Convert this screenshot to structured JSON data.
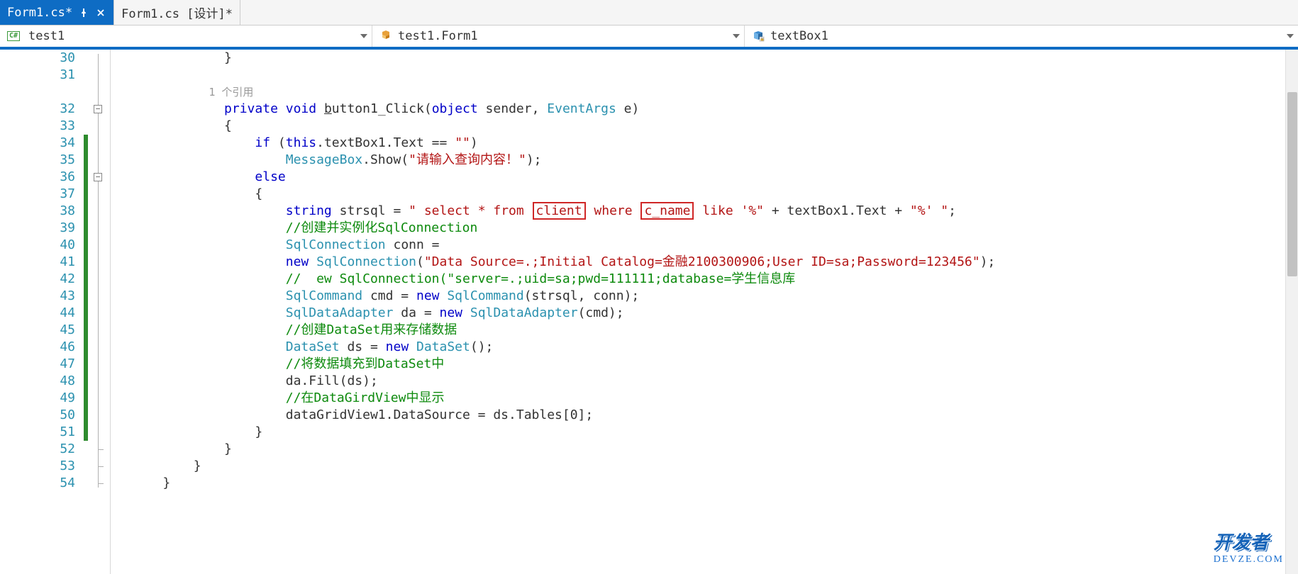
{
  "tabs": [
    {
      "label": "Form1.cs*",
      "active": true,
      "pinned": true,
      "closable": true
    },
    {
      "label": "Form1.cs [设计]*",
      "active": false,
      "pinned": false,
      "closable": false
    }
  ],
  "nav": {
    "namespace": "test1",
    "class": "test1.Form1",
    "member": "textBox1"
  },
  "editor": {
    "first_line": 30,
    "last_line": 54,
    "change_bar_from": 34,
    "change_bar_to": 51,
    "fold_boxes": [
      32,
      36
    ],
    "fold_line_from": 30,
    "fold_line_to": 54,
    "reference_line": 32,
    "reference_text": "1 个引用"
  },
  "code": {
    "30": [
      {
        "t": "            }",
        "c": "c-pun"
      }
    ],
    "31": [
      {
        "t": "",
        "c": ""
      }
    ],
    "32": [
      {
        "t": "            ",
        "c": ""
      },
      {
        "t": "private",
        "c": "c-key"
      },
      {
        "t": " ",
        "c": ""
      },
      {
        "t": "void",
        "c": "c-key"
      },
      {
        "t": " ",
        "c": ""
      },
      {
        "t": "b",
        "c": "c-txt u"
      },
      {
        "t": "utton1_Click(",
        "c": "c-txt"
      },
      {
        "t": "object",
        "c": "c-key"
      },
      {
        "t": " sender, ",
        "c": "c-txt"
      },
      {
        "t": "EventArgs",
        "c": "c-type"
      },
      {
        "t": " e)",
        "c": "c-txt"
      }
    ],
    "33": [
      {
        "t": "            {",
        "c": "c-pun"
      }
    ],
    "34": [
      {
        "t": "                ",
        "c": ""
      },
      {
        "t": "if",
        "c": "c-key"
      },
      {
        "t": " (",
        "c": "c-pun"
      },
      {
        "t": "this",
        "c": "c-key"
      },
      {
        "t": ".textBox1.Text == ",
        "c": "c-txt"
      },
      {
        "t": "\"\"",
        "c": "c-str"
      },
      {
        "t": ")",
        "c": "c-pun"
      }
    ],
    "35": [
      {
        "t": "                    ",
        "c": ""
      },
      {
        "t": "MessageBox",
        "c": "c-type"
      },
      {
        "t": ".Show(",
        "c": "c-txt"
      },
      {
        "t": "\"请输入查询内容！\"",
        "c": "c-str"
      },
      {
        "t": ");",
        "c": "c-pun"
      }
    ],
    "36": [
      {
        "t": "                ",
        "c": ""
      },
      {
        "t": "else",
        "c": "c-key"
      }
    ],
    "37": [
      {
        "t": "                {",
        "c": "c-pun"
      }
    ],
    "38": [
      {
        "t": "                    ",
        "c": ""
      },
      {
        "t": "string",
        "c": "c-key"
      },
      {
        "t": " strsql = ",
        "c": "c-txt"
      },
      {
        "t": "\" select * from ",
        "c": "c-str"
      },
      {
        "t": "client",
        "c": "c-str",
        "box": true
      },
      {
        "t": " where ",
        "c": "c-str"
      },
      {
        "t": "c_name",
        "c": "c-str",
        "box": true
      },
      {
        "t": " like '%\"",
        "c": "c-str"
      },
      {
        "t": " + textBox1.Text + ",
        "c": "c-txt"
      },
      {
        "t": "\"%' \"",
        "c": "c-str"
      },
      {
        "t": ";",
        "c": "c-pun"
      }
    ],
    "39": [
      {
        "t": "                    ",
        "c": ""
      },
      {
        "t": "//创建并实例化SqlConnection",
        "c": "c-cmt"
      }
    ],
    "40": [
      {
        "t": "                    ",
        "c": ""
      },
      {
        "t": "SqlConnection",
        "c": "c-type"
      },
      {
        "t": " conn =",
        "c": "c-txt"
      }
    ],
    "41": [
      {
        "t": "                    ",
        "c": ""
      },
      {
        "t": "new",
        "c": "c-key"
      },
      {
        "t": " ",
        "c": ""
      },
      {
        "t": "SqlConnection",
        "c": "c-type"
      },
      {
        "t": "(",
        "c": "c-pun"
      },
      {
        "t": "\"Data Source=.;Initial Catalog=金融2100300906;User ID=sa;Password=123456\"",
        "c": "c-str"
      },
      {
        "t": ");",
        "c": "c-pun"
      }
    ],
    "42": [
      {
        "t": "                    ",
        "c": ""
      },
      {
        "t": "//  ew SqlConnection(\"server=.;uid=sa;pwd=111111;database=学生信息库",
        "c": "c-cmt"
      }
    ],
    "43": [
      {
        "t": "                    ",
        "c": ""
      },
      {
        "t": "SqlCommand",
        "c": "c-type"
      },
      {
        "t": " cmd = ",
        "c": "c-txt"
      },
      {
        "t": "new",
        "c": "c-key"
      },
      {
        "t": " ",
        "c": ""
      },
      {
        "t": "SqlCommand",
        "c": "c-type"
      },
      {
        "t": "(strsql, conn);",
        "c": "c-txt"
      }
    ],
    "44": [
      {
        "t": "                    ",
        "c": ""
      },
      {
        "t": "SqlDataAdapter",
        "c": "c-type"
      },
      {
        "t": " da = ",
        "c": "c-txt"
      },
      {
        "t": "new",
        "c": "c-key"
      },
      {
        "t": " ",
        "c": ""
      },
      {
        "t": "SqlDataAdapter",
        "c": "c-type"
      },
      {
        "t": "(cmd);",
        "c": "c-txt"
      }
    ],
    "45": [
      {
        "t": "                    ",
        "c": ""
      },
      {
        "t": "//创建DataSet用来存储数据",
        "c": "c-cmt"
      }
    ],
    "46": [
      {
        "t": "                    ",
        "c": ""
      },
      {
        "t": "DataSet",
        "c": "c-type"
      },
      {
        "t": " ds = ",
        "c": "c-txt"
      },
      {
        "t": "new",
        "c": "c-key"
      },
      {
        "t": " ",
        "c": ""
      },
      {
        "t": "DataSet",
        "c": "c-type"
      },
      {
        "t": "();",
        "c": "c-txt"
      }
    ],
    "47": [
      {
        "t": "                    ",
        "c": ""
      },
      {
        "t": "//将数据填充到DataSet中",
        "c": "c-cmt"
      }
    ],
    "48": [
      {
        "t": "                    ",
        "c": ""
      },
      {
        "t": "da.Fill(ds);",
        "c": "c-txt"
      }
    ],
    "49": [
      {
        "t": "                    ",
        "c": ""
      },
      {
        "t": "//在DataGirdView中显示",
        "c": "c-cmt"
      }
    ],
    "50": [
      {
        "t": "                    ",
        "c": ""
      },
      {
        "t": "dataGridView1.DataSource = ds.Tables[0];",
        "c": "c-txt"
      }
    ],
    "51": [
      {
        "t": "                }",
        "c": "c-pun"
      }
    ],
    "52": [
      {
        "t": "            }",
        "c": "c-pun"
      }
    ],
    "53": [
      {
        "t": "        }",
        "c": "c-pun"
      }
    ],
    "54": [
      {
        "t": "    }",
        "c": "c-pun"
      }
    ]
  },
  "watermark": {
    "main": "开发者",
    "sub": "DEVZE.COM"
  }
}
